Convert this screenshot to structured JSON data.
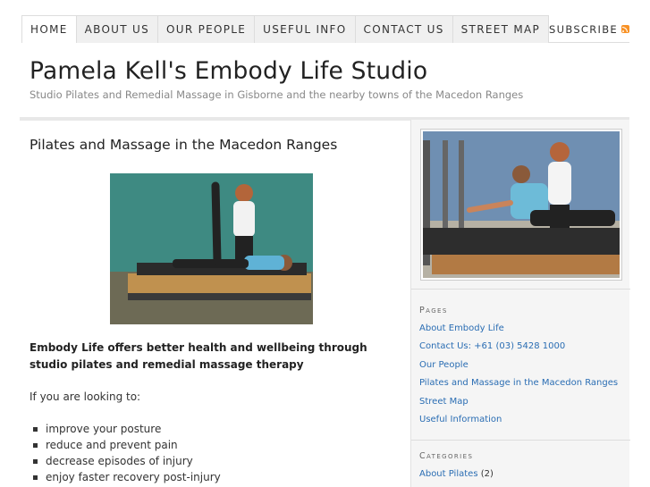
{
  "nav": {
    "items": [
      {
        "label": "HOME",
        "active": true
      },
      {
        "label": "ABOUT US",
        "active": false
      },
      {
        "label": "OUR PEOPLE",
        "active": false
      },
      {
        "label": "USEFUL INFO",
        "active": false
      },
      {
        "label": "CONTACT US",
        "active": false
      },
      {
        "label": "STREET MAP",
        "active": false
      }
    ],
    "subscribe_label": "SUBSCRIBE"
  },
  "header": {
    "title": "Pamela Kell's Embody Life Studio",
    "description": "Studio Pilates and Remedial Massage in Gisborne and the nearby towns of the Macedon Ranges"
  },
  "post": {
    "title": "Pilates and Massage in the Macedon Ranges",
    "intro": "Embody Life offers better health and wellbeing through studio pilates and remedial massage therapy",
    "lead": "If you are looking to:",
    "bullets": [
      "improve your posture",
      "reduce and prevent pain",
      "decrease episodes of injury",
      "enjoy faster recovery post-injury"
    ]
  },
  "sidebar": {
    "pages_title": "Pages",
    "pages": [
      "About Embody Life",
      "Contact Us: +61 (03) 5428 1000",
      "Our People",
      "Pilates and Massage in the Macedon Ranges",
      "Street Map",
      "Useful Information"
    ],
    "categories_title": "Categories",
    "categories": [
      {
        "label": "About Pilates",
        "count": "(2)"
      }
    ]
  },
  "colors": {
    "link": "#2a6db3",
    "rss": "#f89226",
    "sidebar_bg": "#f5f5f5"
  },
  "icons": [
    "rss-icon",
    "bullet-square-icon"
  ]
}
